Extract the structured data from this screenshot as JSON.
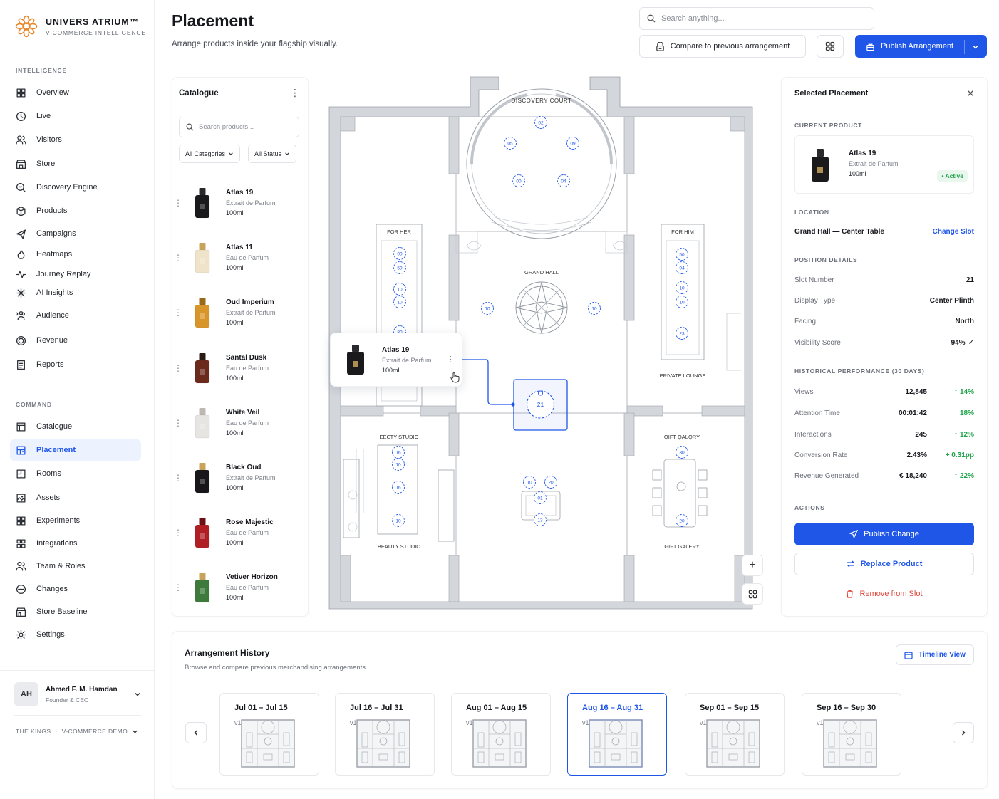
{
  "brand": {
    "name": "UNIVERS ATRIUM™",
    "tagline": "V-COMMERCE INTELLIGENCE"
  },
  "sidebar": {
    "section_intelligence": "INTELLIGENCE",
    "section_command": "COMMAND",
    "intelligence_items": [
      {
        "label": "Overview",
        "icon": "overview-icon"
      },
      {
        "label": "Live",
        "icon": "live-icon"
      },
      {
        "label": "Visitors",
        "icon": "visitors-icon"
      },
      {
        "label": "Store",
        "icon": "store-icon"
      },
      {
        "label": "Discovery Engine",
        "icon": "discovery-icon"
      },
      {
        "label": "Products",
        "icon": "products-icon"
      },
      {
        "label": "Campaigns",
        "icon": "campaigns-icon"
      },
      {
        "label": "Heatmaps",
        "icon": "heatmaps-icon"
      },
      {
        "label": "Journey Replay",
        "icon": "replay-icon"
      },
      {
        "label": "AI Insights",
        "icon": "ai-icon"
      },
      {
        "label": "Audience",
        "icon": "audience-icon"
      },
      {
        "label": "Revenue",
        "icon": "revenue-icon"
      },
      {
        "label": "Reports",
        "icon": "reports-icon"
      }
    ],
    "command_items": [
      {
        "label": "Catalogue",
        "icon": "catalogue-icon"
      },
      {
        "label": "Placement",
        "icon": "placement-icon",
        "active": true
      },
      {
        "label": "Rooms",
        "icon": "rooms-icon"
      },
      {
        "label": "Assets",
        "icon": "assets-icon"
      },
      {
        "label": "Experiments",
        "icon": "experiments-icon"
      },
      {
        "label": "Integrations",
        "icon": "integrations-icon"
      },
      {
        "label": "Team & Roles",
        "icon": "team-icon"
      },
      {
        "label": "Changes",
        "icon": "changes-icon"
      },
      {
        "label": "Store Baseline",
        "icon": "baseline-icon"
      },
      {
        "label": "Settings",
        "icon": "settings-icon"
      }
    ],
    "user": {
      "initials": "AH",
      "name": "Ahmed F. M. Hamdan",
      "role": "Founder & CEO"
    },
    "org": {
      "left": "THE KINGS",
      "sep": "·",
      "right": "V-COMMERCE DEMO"
    }
  },
  "header": {
    "title": "Placement",
    "subtitle": "Arrange products inside your flagship visually.",
    "search_placeholder": "Search anything...",
    "compare_label": "Compare to previous arrangement",
    "publish_label": "Publish Arrangement"
  },
  "catalogue": {
    "title": "Catalogue",
    "search_placeholder": "Search products...",
    "filter_category": "All Categories",
    "filter_status": "All Status",
    "products": [
      {
        "name": "Atlas 19",
        "type": "Extrait de Parfum",
        "size": "100ml",
        "color": "#1a1a1c",
        "cap": "#2a2a2c"
      },
      {
        "name": "Atlas 11",
        "type": "Eau de Parfum",
        "size": "100ml",
        "color": "#efe3c9",
        "cap": "#c8a45a"
      },
      {
        "name": "Oud Imperium",
        "type": "Extrait de Parfum",
        "size": "100ml",
        "color": "#d8962a",
        "cap": "#9a6a18"
      },
      {
        "name": "Santal Dusk",
        "type": "Eau de Parfum",
        "size": "100ml",
        "color": "#6b2a1c",
        "cap": "#2a1a14"
      },
      {
        "name": "White Veil",
        "type": "Eau de Parfum",
        "size": "100ml",
        "color": "#e7e5e2",
        "cap": "#bdb8b1"
      },
      {
        "name": "Black Oud",
        "type": "Extrait de Parfum",
        "size": "100ml",
        "color": "#18161a",
        "cap": "#c8a45a"
      },
      {
        "name": "Rose Majestic",
        "type": "Eau de Parfum",
        "size": "100ml",
        "color": "#b01f24",
        "cap": "#6e1114"
      },
      {
        "name": "Vetiver Horizon",
        "type": "Eau de Parfum",
        "size": "100ml",
        "color": "#3e7a3c",
        "cap": "#c8a45a"
      }
    ]
  },
  "map": {
    "zones": {
      "discovery": "DISCOVERY COURT",
      "for_her": "FOR HER",
      "for_him": "FOR HIM",
      "grand_hall": "GRAND HALL",
      "private_lounge": "PRIVATE LOUNGE",
      "beauty_top": "ЕЕСТY STUDIO",
      "beauty_bottom": "BEAUTY STUDIO",
      "gift_top": "ϘIFT ϘALϘRY",
      "gift_bottom": "GIFT GALERY"
    },
    "slots": {
      "s02": "02",
      "s05": "05",
      "s09": "09",
      "s00": "00",
      "s04": "04",
      "h1": "00",
      "h2": "50",
      "h3": "10",
      "h4": "10",
      "h5": "80",
      "m1": "50",
      "m2": "04",
      "m3": "10",
      "m4": "10",
      "m5": "23",
      "g1": "10",
      "g2": "10",
      "b1": "16",
      "b2": "10",
      "b3": "16",
      "b4": "10",
      "c1": "10",
      "c2": "20",
      "c3": "01",
      "c4": "13",
      "gf1": "30",
      "gf2": "20"
    },
    "selected_slot": "21",
    "drag": {
      "name": "Atlas 19",
      "type": "Extrait de Parfum",
      "size": "100ml"
    }
  },
  "panel": {
    "title": "Selected Placement",
    "current_product_label": "CURRENT PRODUCT",
    "product": {
      "name": "Atlas 19",
      "type": "Extrait de Parfum",
      "size": "100ml",
      "status": "Active"
    },
    "location_label": "LOCATION",
    "location": "Grand Hall — Center Table",
    "change_slot": "Change Slot",
    "position_label": "POSITION DETAILS",
    "position": [
      {
        "k": "Slot Number",
        "v": "21"
      },
      {
        "k": "Display Type",
        "v": "Center Plinth"
      },
      {
        "k": "Facing",
        "v": "North"
      },
      {
        "k": "Visibility Score",
        "v": "94%"
      }
    ],
    "history_label": "HISTORICAL PERFORMANCE (30 DAYS)",
    "history": [
      {
        "k": "Views",
        "v": "12,845",
        "d": "14%"
      },
      {
        "k": "Attention Time",
        "v": "00:01:42",
        "d": "18%"
      },
      {
        "k": "Interactions",
        "v": "245",
        "d": "12%"
      },
      {
        "k": "Conversion Rate",
        "v": "2.43%",
        "d": "+ 0.31pp"
      },
      {
        "k": "Revenue Generated",
        "v": "€ 18,240",
        "d": "22%"
      }
    ],
    "actions_label": "ACTIONS",
    "publish": "Publish Change",
    "replace": "Replace Product",
    "remove": "Remove from Slot"
  },
  "arrangement": {
    "title": "Arrangement History",
    "subtitle": "Browse and compare previous merchandising arrangements.",
    "timeline": "Timeline View",
    "items": [
      {
        "dates": "Jul 01 – Jul 15",
        "version": "v1.12"
      },
      {
        "dates": "Jul 16 – Jul 31",
        "version": "v1.13"
      },
      {
        "dates": "Aug 01 – Aug 15",
        "version": "v1.15"
      },
      {
        "dates": "Aug 16 – Aug 31",
        "version": "v1.15",
        "selected": true
      },
      {
        "dates": "Sep 01 – Sep 15",
        "version": "v1.16"
      },
      {
        "dates": "Sep 16 – Sep 30",
        "version": "v1.17"
      }
    ]
  },
  "colors": {
    "accent": "#1f56e8",
    "success": "#1fa34a",
    "danger": "#e0463a",
    "brand_mark": "#e8862a"
  }
}
